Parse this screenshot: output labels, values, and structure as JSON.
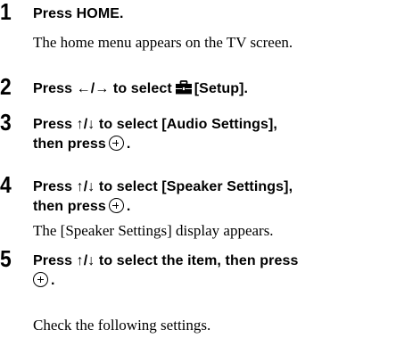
{
  "steps": [
    {
      "number": "1",
      "instruction": "Press HOME.",
      "result": "The home menu appears on the TV screen."
    },
    {
      "number": "2",
      "instruction_before_icon": "Press ←/→ to select",
      "icon": "toolbox-icon",
      "instruction_after_icon": "[Setup]."
    },
    {
      "number": "3",
      "instruction_line1": "Press ↑/↓ to select [Audio Settings],",
      "instruction_line2": "then press",
      "icon": "enter-button-icon",
      "instruction_end": "."
    },
    {
      "number": "4",
      "instruction_line1": "Press ↑/↓ to select [Speaker Settings],",
      "instruction_line2": "then press",
      "icon": "enter-button-icon",
      "instruction_end": ".",
      "result": "The [Speaker Settings] display appears."
    },
    {
      "number": "5",
      "instruction_line1": "Press ↑/↓ to select the item, then press",
      "icon": "enter-button-icon",
      "instruction_end": ".",
      "result": "Check the following settings."
    }
  ]
}
